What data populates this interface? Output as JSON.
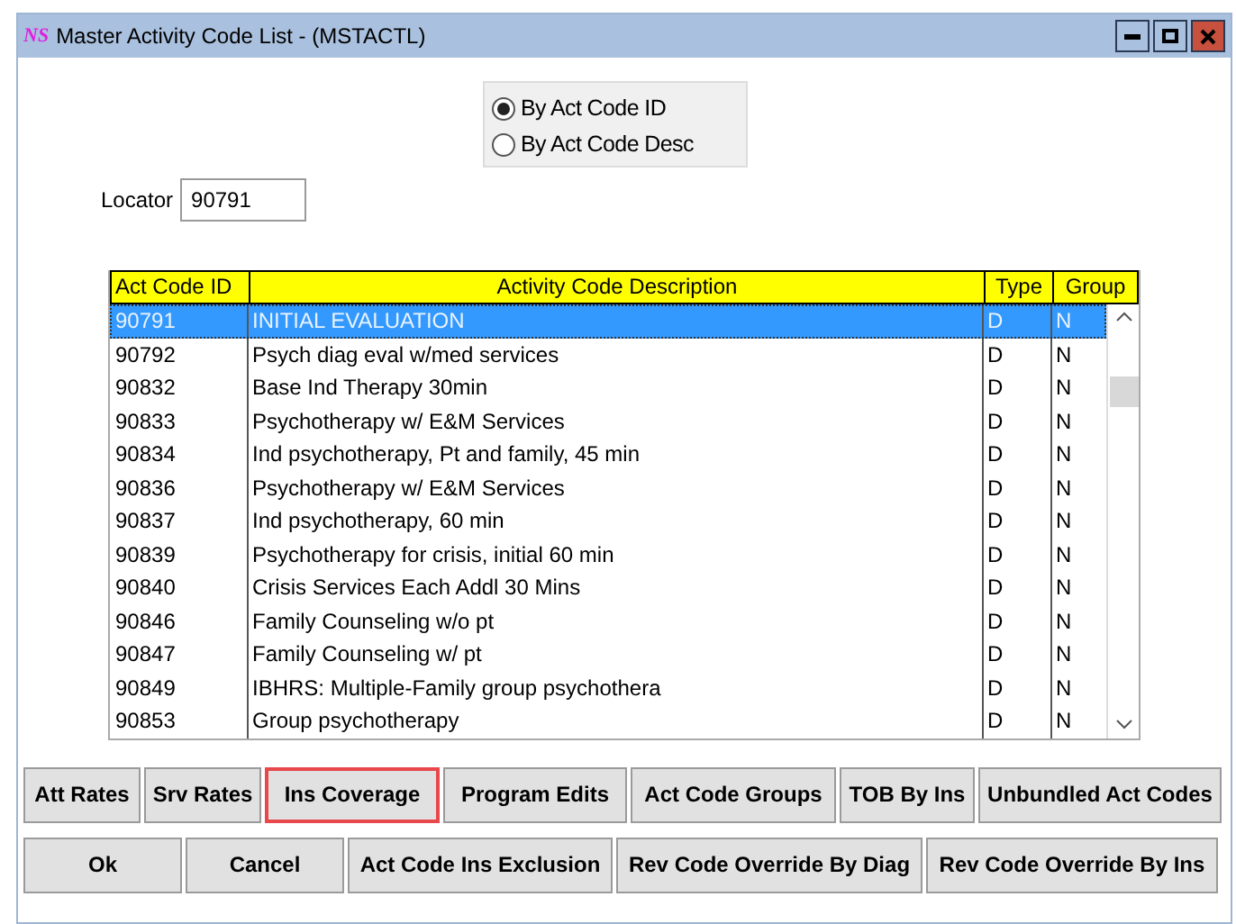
{
  "window": {
    "logo": "NS",
    "title": "Master Activity Code List - (MSTACTL)"
  },
  "sort_options": [
    {
      "label": "By Act Code ID",
      "selected": true
    },
    {
      "label": "By Act Code Desc",
      "selected": false
    }
  ],
  "locator": {
    "label": "Locator",
    "value": "90791"
  },
  "table": {
    "columns": [
      "Act Code ID",
      "Activity Code Description",
      "Type",
      "Group"
    ],
    "rows": [
      {
        "cells": [
          "90791",
          "INITIAL EVALUATION",
          "D",
          "N"
        ],
        "selected": true
      },
      {
        "cells": [
          "90792",
          "Psych diag eval w/med services",
          "D",
          "N"
        ],
        "selected": false
      },
      {
        "cells": [
          "90832",
          "Base Ind Therapy 30min",
          "D",
          "N"
        ],
        "selected": false
      },
      {
        "cells": [
          "90833",
          "Psychotherapy w/ E&M Services",
          "D",
          "N"
        ],
        "selected": false
      },
      {
        "cells": [
          "90834",
          "Ind psychotherapy, Pt and family, 45 min",
          "D",
          "N"
        ],
        "selected": false
      },
      {
        "cells": [
          "90836",
          "Psychotherapy w/ E&M Services",
          "D",
          "N"
        ],
        "selected": false
      },
      {
        "cells": [
          "90837",
          "Ind psychotherapy, 60 min",
          "D",
          "N"
        ],
        "selected": false
      },
      {
        "cells": [
          "90839",
          "Psychotherapy for crisis, initial 60 min",
          "D",
          "N"
        ],
        "selected": false
      },
      {
        "cells": [
          "90840",
          "Crisis Services Each Addl 30 Mins",
          "D",
          "N"
        ],
        "selected": false
      },
      {
        "cells": [
          "90846",
          "Family Counseling w/o pt",
          "D",
          "N"
        ],
        "selected": false
      },
      {
        "cells": [
          "90847",
          "Family Counseling w/ pt",
          "D",
          "N"
        ],
        "selected": false
      },
      {
        "cells": [
          "90849",
          "IBHRS: Multiple-Family group psychothera",
          "D",
          "N"
        ],
        "selected": false
      },
      {
        "cells": [
          "90853",
          "Group psychotherapy",
          "D",
          "N"
        ],
        "selected": false
      }
    ]
  },
  "button_rows": [
    [
      {
        "label": "Att Rates",
        "highlighted": false
      },
      {
        "label": "Srv Rates",
        "highlighted": false
      },
      {
        "label": "Ins Coverage",
        "highlighted": true
      },
      {
        "label": "Program Edits",
        "highlighted": false
      },
      {
        "label": "Act Code Groups",
        "highlighted": false
      },
      {
        "label": "TOB By Ins",
        "highlighted": false
      },
      {
        "label": "Unbundled Act Codes",
        "highlighted": false
      }
    ],
    [
      {
        "label": "Ok",
        "highlighted": false
      },
      {
        "label": "Cancel",
        "highlighted": false
      },
      {
        "label": "Act Code Ins Exclusion",
        "highlighted": false
      },
      {
        "label": "Rev Code Override By Diag",
        "highlighted": false
      },
      {
        "label": "Rev Code Override By Ins",
        "highlighted": false
      }
    ]
  ]
}
